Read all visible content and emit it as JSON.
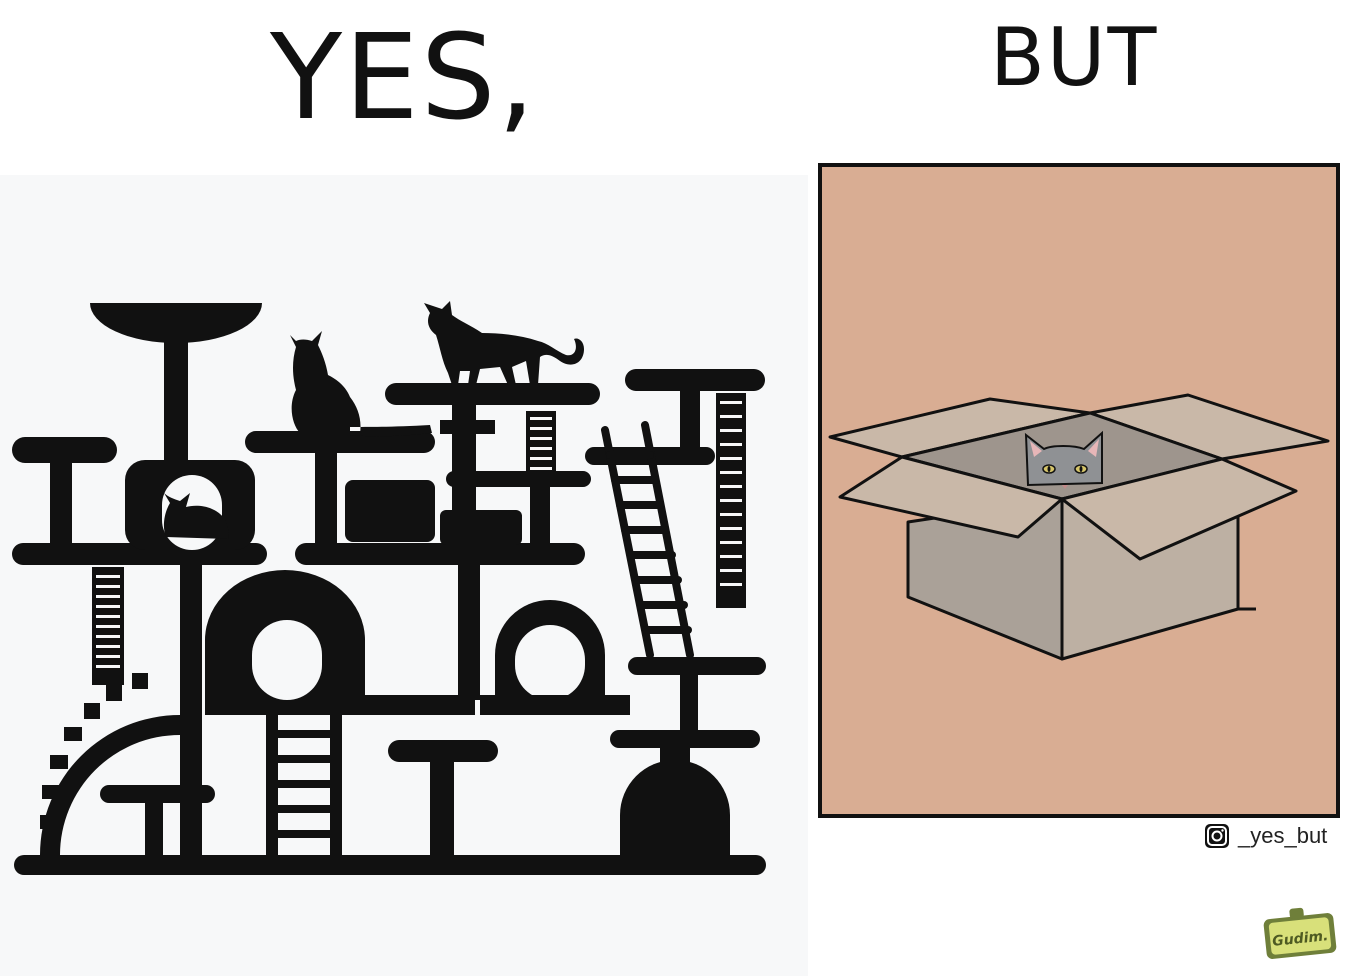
{
  "headings": {
    "left": "YES,",
    "right": "BUT"
  },
  "credit": {
    "icon": "instagram-icon",
    "handle": "_yes_but"
  },
  "logo": {
    "text": "Gudim."
  },
  "colors": {
    "ink": "#111111",
    "left_background": "#f7f8f9",
    "right_background": "#d9ad93",
    "box_light": "#c9b8a8",
    "box_shade": "#aaa198",
    "cat_gray": "#8f9194",
    "cat_eye": "#d6c56a",
    "logo_green": "#6f7f3a",
    "logo_paper": "#d8e07a"
  }
}
